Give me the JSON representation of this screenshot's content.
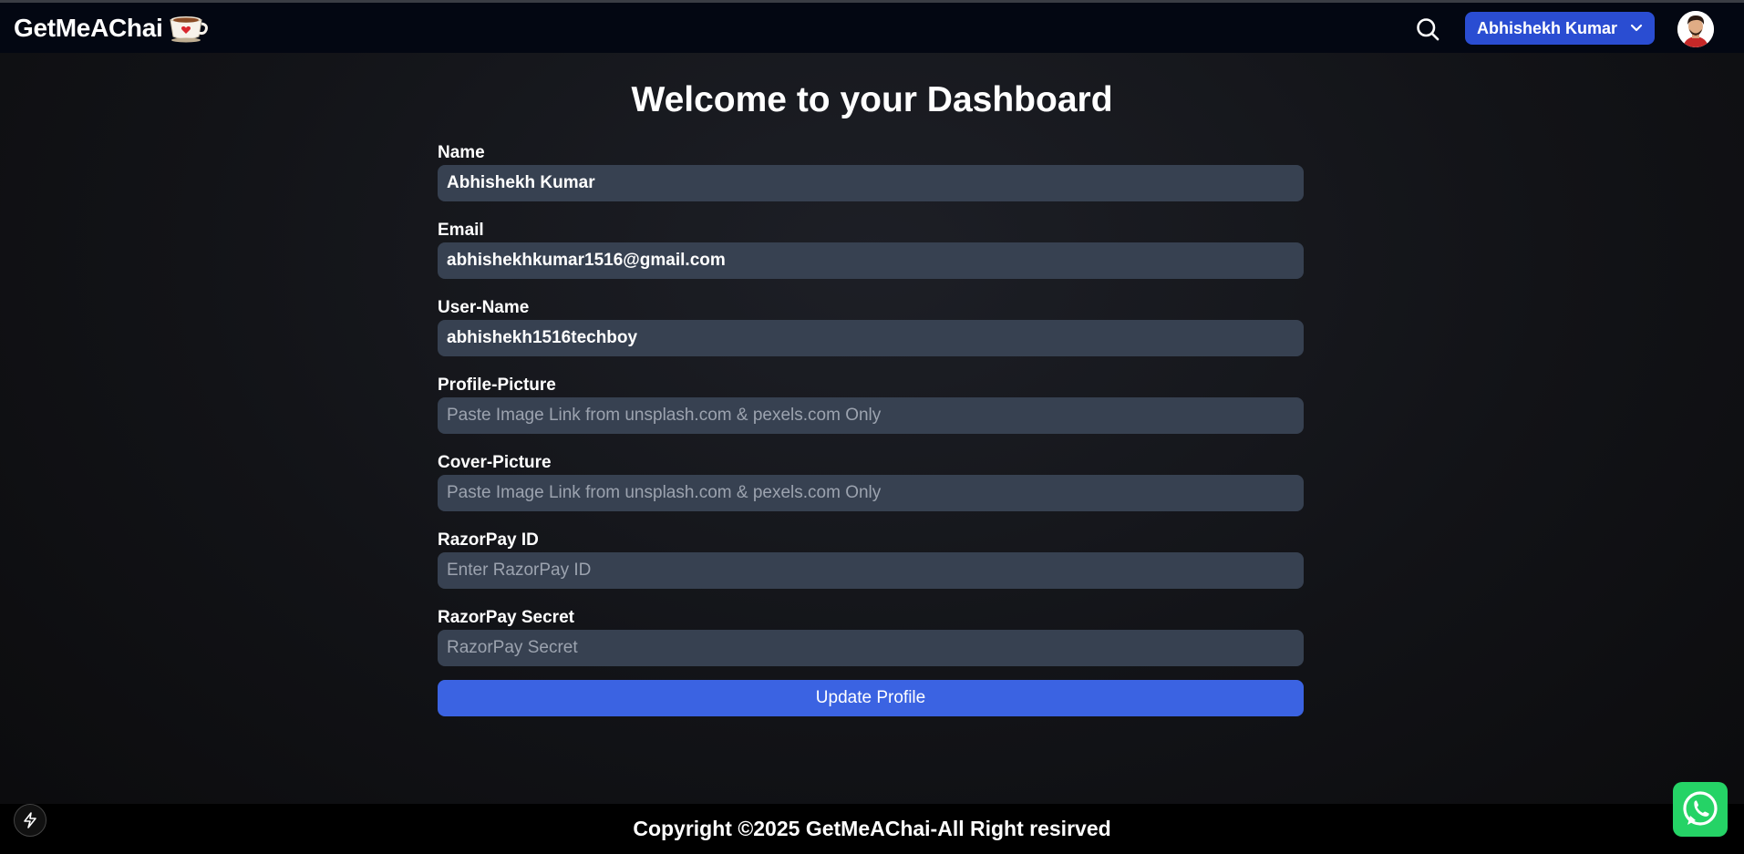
{
  "navbar": {
    "brand": "GetMeAChai",
    "user_button_label": "Abhishekh Kumar",
    "icons": [
      "cup-icon",
      "search-icon",
      "chevron-down-icon",
      "avatar"
    ]
  },
  "main": {
    "title": "Welcome to your Dashboard",
    "fields": [
      {
        "label": "Name",
        "value": "Abhishekh Kumar",
        "placeholder": ""
      },
      {
        "label": "Email",
        "value": "abhishekhkumar1516@gmail.com",
        "placeholder": ""
      },
      {
        "label": "User-Name",
        "value": "abhishekh1516techboy",
        "placeholder": ""
      },
      {
        "label": "Profile-Picture",
        "value": "",
        "placeholder": "Paste Image Link from unsplash.com & pexels.com Only"
      },
      {
        "label": "Cover-Picture",
        "value": "",
        "placeholder": "Paste Image Link from unsplash.com & pexels.com Only"
      },
      {
        "label": "RazorPay ID",
        "value": "",
        "placeholder": "Enter RazorPay ID"
      },
      {
        "label": "RazorPay Secret",
        "value": "",
        "placeholder": "RazorPay Secret"
      }
    ],
    "submit_label": "Update Profile"
  },
  "footer": {
    "copyright": "Copyright ©2025 GetMeAChai-All Right resirved"
  },
  "colors": {
    "navbar_bg": "#030712",
    "accent": "#3b63e2",
    "user_button": "#2a4dd2",
    "input_bg": "#374151",
    "whatsapp": "#25d366"
  }
}
